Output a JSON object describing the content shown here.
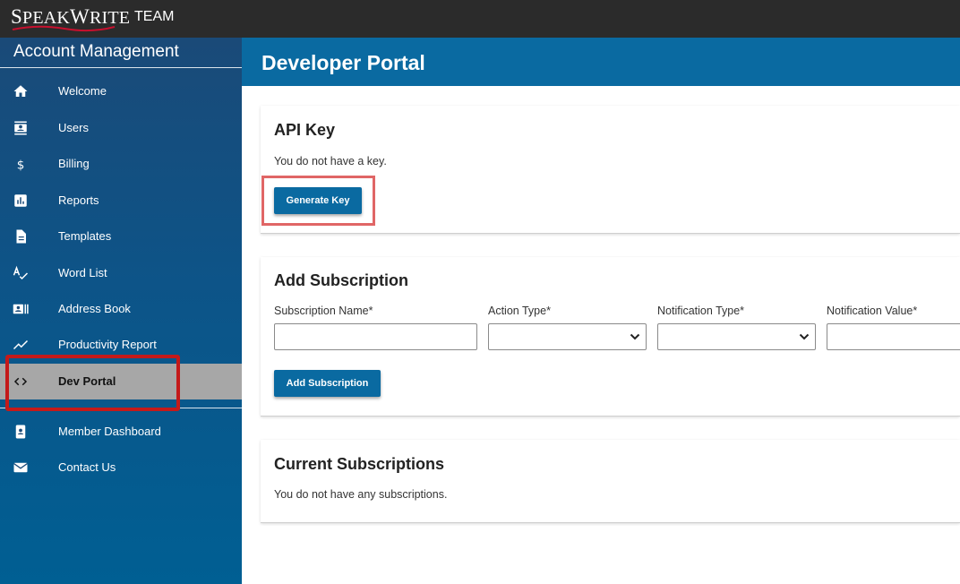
{
  "topbar": {
    "logo": "SpeakWrite",
    "logo_big_s": "S",
    "logo_rest_1": "PEAK",
    "logo_big_w": "W",
    "logo_rest_2": "RITE",
    "team": "TEAM"
  },
  "sidebar": {
    "title": "Account Management",
    "items": [
      {
        "label": "Welcome",
        "icon": "home-icon"
      },
      {
        "label": "Users",
        "icon": "contacts-icon"
      },
      {
        "label": "Billing",
        "icon": "dollar-icon"
      },
      {
        "label": "Reports",
        "icon": "bar-chart-icon"
      },
      {
        "label": "Templates",
        "icon": "document-icon"
      },
      {
        "label": "Word List",
        "icon": "spellcheck-icon"
      },
      {
        "label": "Address Book",
        "icon": "address-card-icon"
      },
      {
        "label": "Productivity Report",
        "icon": "trend-line-icon"
      },
      {
        "label": "Dev Portal",
        "icon": "code-icon",
        "active": true
      },
      {
        "label": "Member Dashboard",
        "icon": "badge-icon"
      },
      {
        "label": "Contact Us",
        "icon": "mail-icon"
      }
    ]
  },
  "header": {
    "title": "Developer Portal"
  },
  "api_key": {
    "heading": "API Key",
    "message": "You do not have a key.",
    "button": "Generate Key"
  },
  "add_subscription": {
    "heading": "Add Subscription",
    "fields": {
      "name_label": "Subscription Name*",
      "action_label": "Action Type*",
      "notification_type_label": "Notification Type*",
      "notification_value_label": "Notification Value*"
    },
    "name_value": "",
    "action_value": "",
    "notification_type_value": "",
    "notification_value_value": "",
    "button": "Add Subscription"
  },
  "current_subscriptions": {
    "heading": "Current Subscriptions",
    "message": "You do not have any subscriptions."
  },
  "colors": {
    "header_blue": "#0a6aa1",
    "highlight_red": "#c41a1a",
    "highlight_pink": "#e06666"
  }
}
